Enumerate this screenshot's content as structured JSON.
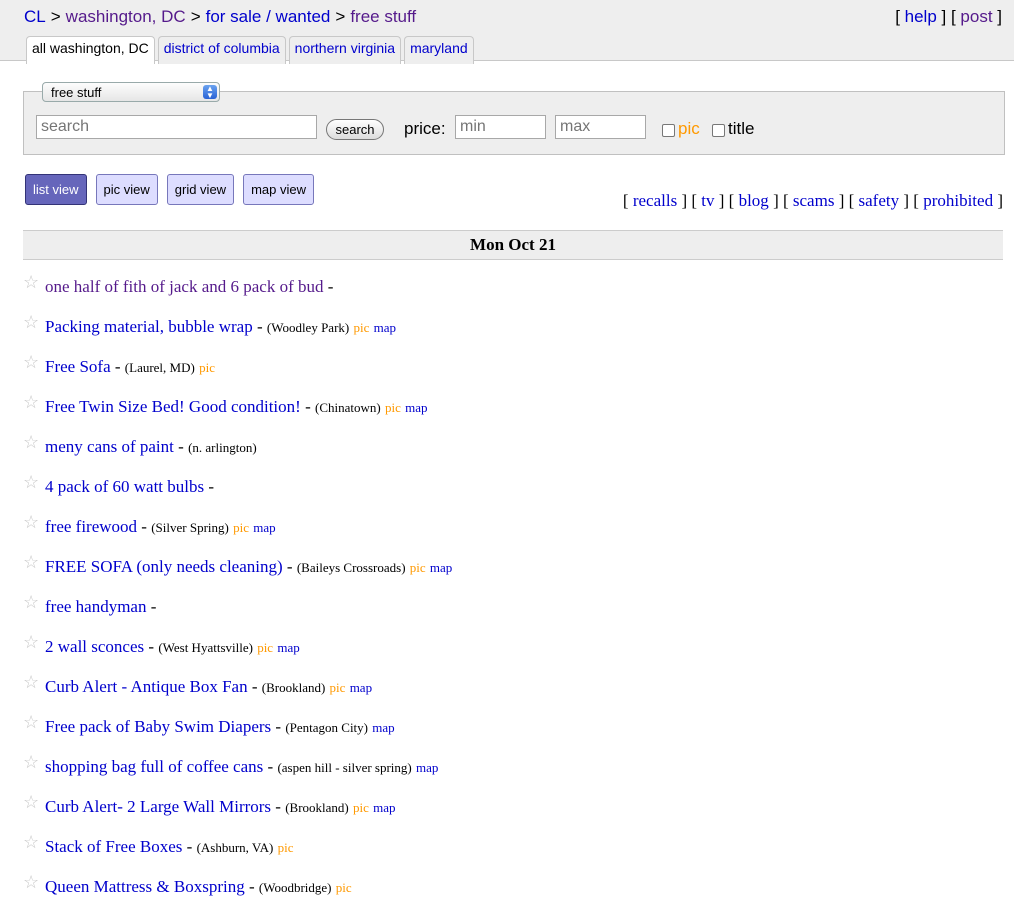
{
  "header": {
    "breadcrumb": {
      "cl": "CL",
      "city": "washington, DC",
      "section": "for sale / wanted",
      "category": "free stuff",
      "sep": ">"
    },
    "help": "help",
    "post": "post"
  },
  "tabs": [
    {
      "label": "all washington, DC",
      "active": true
    },
    {
      "label": "district of columbia",
      "active": false
    },
    {
      "label": "northern virginia",
      "active": false
    },
    {
      "label": "maryland",
      "active": false
    }
  ],
  "search": {
    "category_selected": "free stuff",
    "query_placeholder": "search",
    "button_label": "search",
    "price_label": "price:",
    "min_placeholder": "min",
    "max_placeholder": "max",
    "pic_label": "pic",
    "title_label": "title"
  },
  "views": {
    "list": "list view",
    "pic": "pic view",
    "grid": "grid view",
    "map": "map view"
  },
  "toplinks": {
    "recalls": "recalls",
    "tv": "tv",
    "blog": "blog",
    "scams": "scams",
    "safety": "safety",
    "prohibited": "prohibited"
  },
  "date_header": "Mon Oct 21",
  "listing_tags": {
    "pic": "pic",
    "map": "map",
    "dash": "-"
  },
  "listings": [
    {
      "title": "one half of fith of jack and 6 pack of bud",
      "location": "",
      "pic": false,
      "map": false,
      "visited": true
    },
    {
      "title": "Packing material, bubble wrap",
      "location": "(Woodley Park)",
      "pic": true,
      "map": true,
      "visited": false
    },
    {
      "title": "Free Sofa",
      "location": "(Laurel, MD)",
      "pic": true,
      "map": false,
      "visited": false
    },
    {
      "title": "Free Twin Size Bed! Good condition!",
      "location": "(Chinatown)",
      "pic": true,
      "map": true,
      "visited": false
    },
    {
      "title": "meny cans of paint",
      "location": "(n. arlington)",
      "pic": false,
      "map": false,
      "visited": false
    },
    {
      "title": "4 pack of 60 watt bulbs",
      "location": "",
      "pic": false,
      "map": false,
      "visited": false
    },
    {
      "title": "free firewood",
      "location": "(Silver Spring)",
      "pic": true,
      "map": true,
      "visited": false
    },
    {
      "title": "FREE SOFA (only needs cleaning)",
      "location": "(Baileys Crossroads)",
      "pic": true,
      "map": true,
      "visited": false
    },
    {
      "title": "free handyman",
      "location": "",
      "pic": false,
      "map": false,
      "visited": false
    },
    {
      "title": "2 wall sconces",
      "location": "(West Hyattsville)",
      "pic": true,
      "map": true,
      "visited": false
    },
    {
      "title": "Curb Alert - Antique Box Fan",
      "location": "(Brookland)",
      "pic": true,
      "map": true,
      "visited": false
    },
    {
      "title": "Free pack of Baby Swim Diapers",
      "location": "(Pentagon City)",
      "pic": false,
      "map": true,
      "visited": false
    },
    {
      "title": "shopping bag full of coffee cans",
      "location": "(aspen hill - silver spring)",
      "pic": false,
      "map": true,
      "visited": false
    },
    {
      "title": "Curb Alert- 2 Large Wall Mirrors",
      "location": "(Brookland)",
      "pic": true,
      "map": true,
      "visited": false
    },
    {
      "title": "Stack of Free Boxes",
      "location": "(Ashburn, VA)",
      "pic": true,
      "map": false,
      "visited": false
    },
    {
      "title": "Queen Mattress & Boxspring",
      "location": "(Woodbridge)",
      "pic": true,
      "map": false,
      "visited": false
    }
  ]
}
